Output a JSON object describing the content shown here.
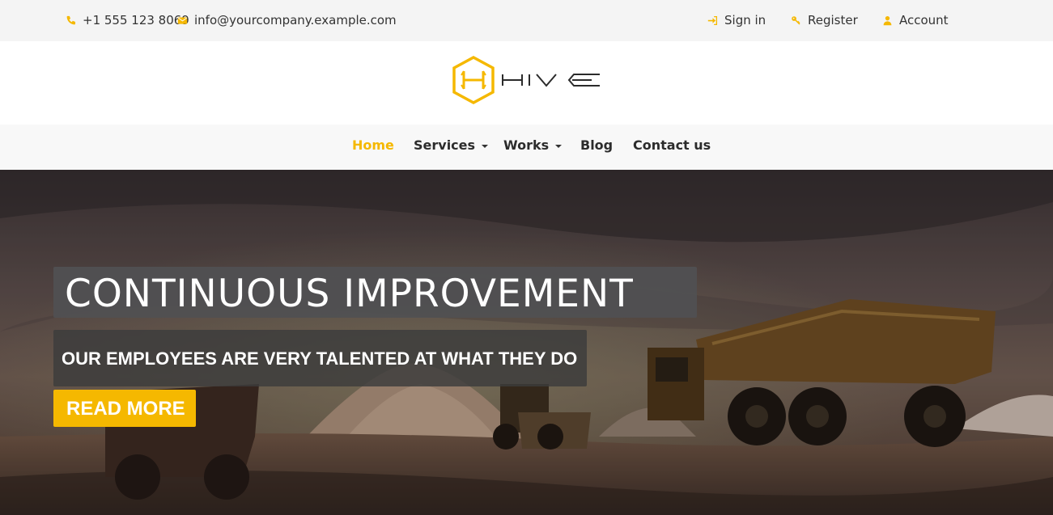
{
  "topbar": {
    "phone": "+1 555 123 8069",
    "email": "info@yourcompany.example.com",
    "sign_in": "Sign in",
    "register": "Register",
    "account": "Account"
  },
  "logo": {
    "text": "HIVE"
  },
  "nav": {
    "items": [
      {
        "label": "Home",
        "active": true
      },
      {
        "label": "Services",
        "dropdown": true
      },
      {
        "label": "Works",
        "dropdown": true
      },
      {
        "label": "Blog"
      },
      {
        "label": "Contact us"
      }
    ]
  },
  "hero": {
    "title": "CONTINUOUS IMPROVEMENT",
    "subtitle": "OUR EMPLOYEES ARE VERY TALENTED AT WHAT THEY DO",
    "button": "READ MORE"
  },
  "colors": {
    "accent": "#f5b800",
    "topbar_bg": "#f4f4f4",
    "nav_bg": "#f8f8f8"
  }
}
